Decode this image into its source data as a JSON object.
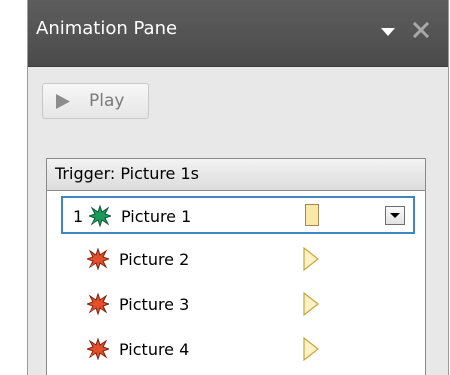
{
  "pane": {
    "title": "Animation Pane",
    "menu_icon": "chevron-down-icon",
    "close_icon": "close-icon"
  },
  "toolbar": {
    "play_label": "Play",
    "play_icon": "play-icon"
  },
  "list": {
    "trigger_label": "Trigger: Picture 1s",
    "items": [
      {
        "number": "1",
        "label": "Picture 1",
        "icon": "burst-green-icon",
        "timing": "bar",
        "selected": true
      },
      {
        "number": "",
        "label": "Picture 2",
        "icon": "burst-red-icon",
        "timing": "arrow",
        "selected": false
      },
      {
        "number": "",
        "label": "Picture 3",
        "icon": "burst-red-icon",
        "timing": "arrow",
        "selected": false
      },
      {
        "number": "",
        "label": "Picture 4",
        "icon": "burst-red-icon",
        "timing": "arrow",
        "selected": false
      }
    ]
  },
  "colors": {
    "titlebar": "#4f4f4f",
    "selection_border": "#3f86c7",
    "timing_fill": "#fbe7a6",
    "effect_green": "#1c9a5a",
    "effect_red": "#e5502b"
  }
}
